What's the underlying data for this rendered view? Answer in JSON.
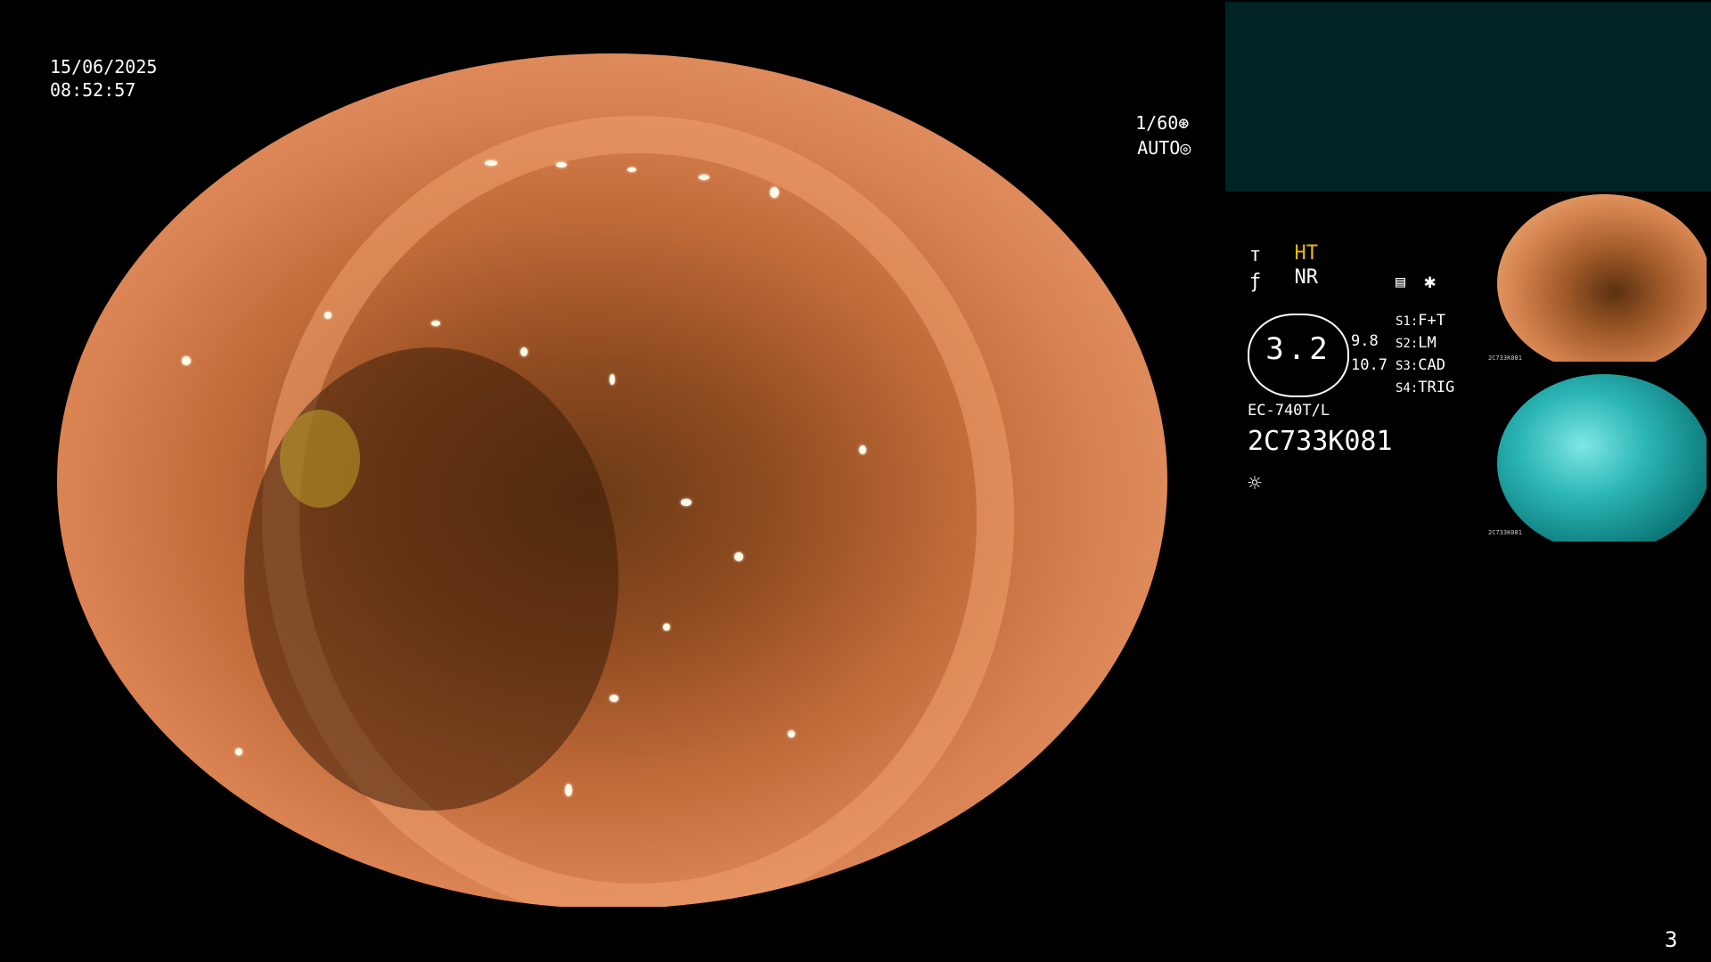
{
  "overlay": {
    "date": "15/06/2025",
    "time": "08:52:57",
    "shutter": "1/60",
    "exposure_mode": "AUTO",
    "page_number": "3"
  },
  "settings": {
    "ht_label": "HT",
    "nr_label": "NR",
    "dial_value": "3.2",
    "value_a": "9.8",
    "value_b": "10.7",
    "switches": [
      {
        "key": "S1:",
        "value": "F+T"
      },
      {
        "key": "S2:",
        "value": "LM"
      },
      {
        "key": "S3:",
        "value": "CAD"
      },
      {
        "key": "S4:",
        "value": "TRIG"
      }
    ],
    "scope_model": "EC-740T/L",
    "serial": "2C733K081"
  },
  "thumbnails": [
    {
      "caption": "2C733K081"
    },
    {
      "caption": "2C733K081"
    }
  ],
  "colors": {
    "ht_color": "#f2b800",
    "panel_bg": "#002324",
    "text": "#ffffff"
  },
  "icons": [
    "shutter-icon",
    "auto-iris-icon",
    "structure-icon",
    "enhancement-icon",
    "memo-icon",
    "asterisk-icon",
    "light-icon"
  ]
}
